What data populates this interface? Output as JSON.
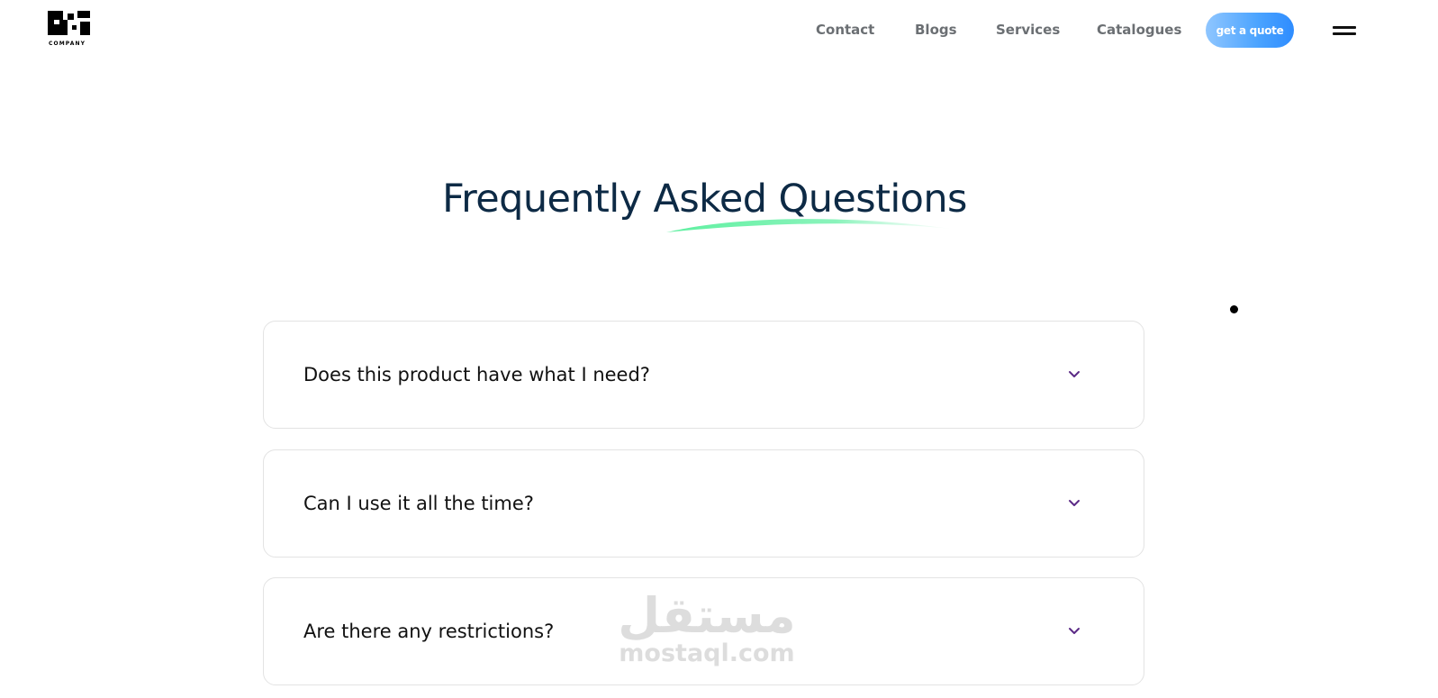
{
  "header": {
    "logo_text": "COMPANY",
    "nav": [
      {
        "label": "Contact"
      },
      {
        "label": "Blogs"
      },
      {
        "label": "Services"
      },
      {
        "label": "Catalogues"
      }
    ],
    "cta_label": "get a quote",
    "menu_icon": "hamburger-menu-icon"
  },
  "faq": {
    "title": "Frequently Asked Questions",
    "items": [
      {
        "question": "Does this product have what I need?",
        "icon": "chevron-down-icon"
      },
      {
        "question": "Can I use it all the time?",
        "icon": "chevron-down-icon"
      },
      {
        "question": "Are there any restrictions?",
        "icon": "chevron-down-icon"
      }
    ]
  },
  "watermark": {
    "arabic": "مستقل",
    "latin": "mostaql.com"
  },
  "colors": {
    "title": "#0d2a45",
    "nav_text": "#6b6f73",
    "cta_start": "#8fc6ff",
    "cta_end": "#2e8cff",
    "swoosh": "#5ef0a0",
    "chevron": "#5b2a86",
    "card_border": "#e3e3e3"
  }
}
